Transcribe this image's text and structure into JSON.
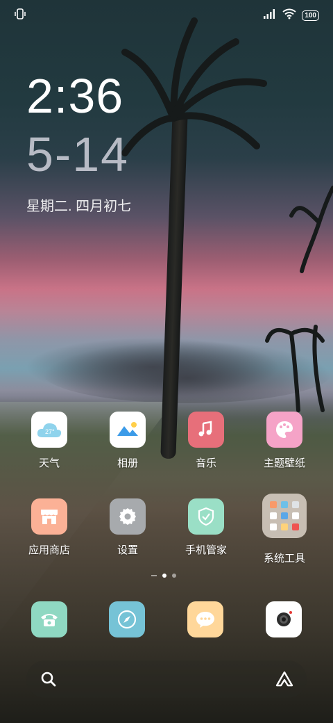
{
  "status": {
    "battery": "100"
  },
  "lockclock": {
    "time": "2:36",
    "date": "5-14",
    "lunar": "星期二. 四月初七"
  },
  "apps": [
    {
      "label": "天气",
      "temp": "27°",
      "color": "#ffffff"
    },
    {
      "label": "相册",
      "color": "#ffffff"
    },
    {
      "label": "音乐",
      "color": "#e76f7a"
    },
    {
      "label": "主题壁纸",
      "color": "#f5a3c7"
    },
    {
      "label": "应用商店",
      "color": "#fbb196"
    },
    {
      "label": "设置",
      "color": "#a7aaad"
    },
    {
      "label": "手机管家",
      "color": "#9adfc6"
    },
    {
      "label": "系统工具",
      "color": "#d8d0c8"
    }
  ],
  "dock": [
    {
      "name": "phone-app",
      "color": "#8fd8c2"
    },
    {
      "name": "browser-app",
      "color": "#76c3d6"
    },
    {
      "name": "messages-app",
      "color": "#ffd79a"
    },
    {
      "name": "camera-app",
      "color": "#ffffff"
    }
  ]
}
